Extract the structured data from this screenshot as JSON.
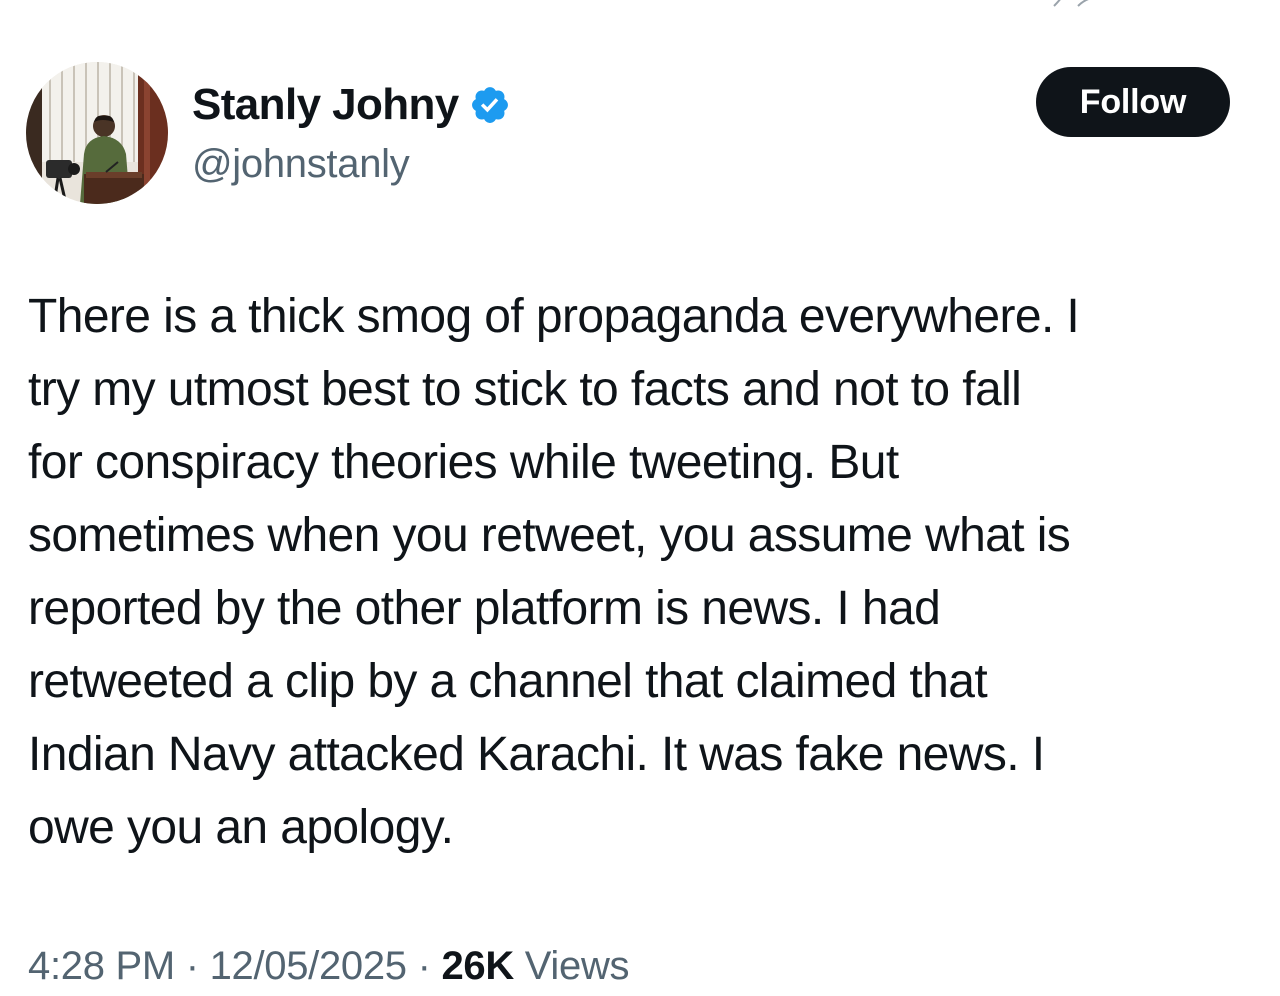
{
  "author": {
    "display_name": "Stanly Johny",
    "handle": "@johnstanly",
    "verified": true,
    "verified_badge_color": "#1d9bf0"
  },
  "follow_button": {
    "label": "Follow",
    "background": "#0f1419",
    "text_color": "#ffffff"
  },
  "tweet": {
    "text": "There is a thick smog of propaganda everywhere. I\ntry my utmost best to stick to facts and not to fall\nfor conspiracy theories while tweeting. But\nsometimes when you retweet, you assume what is\nreported by the other platform is news. I had\nretweeted a clip by a channel that claimed that\nIndian Navy attacked Karachi. It was fake news. I\nowe you an apology."
  },
  "meta": {
    "time": "4:28 PM",
    "separator": "·",
    "date": "12/05/2025",
    "views_count": "26K",
    "views_label": "Views"
  },
  "icons": {
    "avatar": "profile-photo",
    "badge": "verified-badge-icon"
  }
}
